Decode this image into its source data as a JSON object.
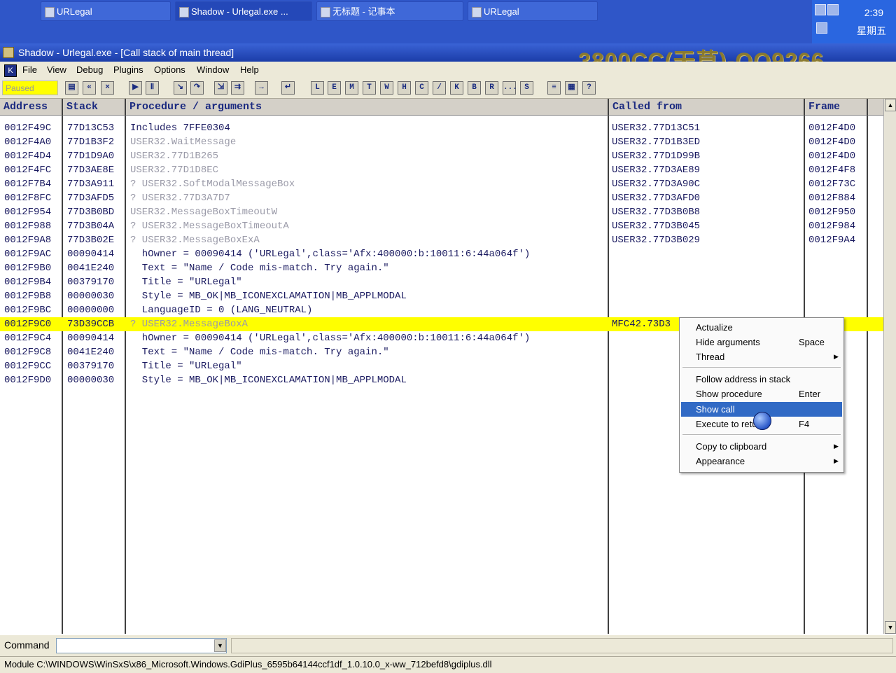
{
  "taskbar": {
    "tasks": [
      {
        "label": "URLegal"
      },
      {
        "label": "Shadow - Urlegal.exe ..."
      },
      {
        "label": "无标题 - 记事本"
      },
      {
        "label": "URLegal"
      }
    ],
    "clock": "2:39",
    "weekday": "星期五"
  },
  "window": {
    "title": "Shadow - Urlegal.exe - [Call stack of main thread]",
    "watermark": "3800CC(天草)-QQ9266…"
  },
  "menubar": {
    "items": [
      "File",
      "View",
      "Debug",
      "Plugins",
      "Options",
      "Window",
      "Help"
    ]
  },
  "toolbar": {
    "status": "Paused",
    "letter_buttons": [
      "L",
      "E",
      "M",
      "T",
      "W",
      "H",
      "C",
      "/",
      "K",
      "B",
      "R",
      "...",
      "S"
    ]
  },
  "table": {
    "headers": [
      "Address",
      "Stack",
      "Procedure / arguments",
      "Called from",
      "Frame"
    ],
    "rows": [
      {
        "addr": "0012F49C",
        "stack": "77D13C53",
        "proc": "Includes 7FFE0304",
        "call": "USER32.77D13C51",
        "frame": "0012F4D0"
      },
      {
        "addr": "0012F4A0",
        "stack": "77D1B3F2",
        "proc": "USER32.WaitMessage",
        "call": "USER32.77D1B3ED",
        "frame": "0012F4D0"
      },
      {
        "addr": "0012F4D4",
        "stack": "77D1D9A0",
        "proc": "USER32.77D1B265",
        "call": "USER32.77D1D99B",
        "frame": "0012F4D0"
      },
      {
        "addr": "0012F4FC",
        "stack": "77D3AE8E",
        "proc": "USER32.77D1D8EC",
        "call": "USER32.77D3AE89",
        "frame": "0012F4F8"
      },
      {
        "addr": "0012F7B4",
        "stack": "77D3A911",
        "proc": "? USER32.SoftModalMessageBox",
        "call": "USER32.77D3A90C",
        "frame": "0012F73C"
      },
      {
        "addr": "0012F8FC",
        "stack": "77D3AFD5",
        "proc": "? USER32.77D3A7D7",
        "call": "USER32.77D3AFD0",
        "frame": "0012F884"
      },
      {
        "addr": "0012F954",
        "stack": "77D3B0BD",
        "proc": "USER32.MessageBoxTimeoutW",
        "call": "USER32.77D3B0B8",
        "frame": "0012F950"
      },
      {
        "addr": "0012F988",
        "stack": "77D3B04A",
        "proc": "? USER32.MessageBoxTimeoutA",
        "call": "USER32.77D3B045",
        "frame": "0012F984"
      },
      {
        "addr": "0012F9A8",
        "stack": "77D3B02E",
        "proc": "? USER32.MessageBoxExA",
        "call": "USER32.77D3B029",
        "frame": "0012F9A4"
      },
      {
        "addr": "0012F9AC",
        "stack": "00090414",
        "proc": "  hOwner = 00090414 ('URLegal',class='Afx:400000:b:10011:6:44a064f')",
        "call": "",
        "frame": ""
      },
      {
        "addr": "0012F9B0",
        "stack": "0041E240",
        "proc": "  Text = \"Name / Code mis-match. Try again.\"",
        "call": "",
        "frame": ""
      },
      {
        "addr": "0012F9B4",
        "stack": "00379170",
        "proc": "  Title = \"URLegal\"",
        "call": "",
        "frame": ""
      },
      {
        "addr": "0012F9B8",
        "stack": "00000030",
        "proc": "  Style = MB_OK|MB_ICONEXCLAMATION|MB_APPLMODAL",
        "call": "",
        "frame": ""
      },
      {
        "addr": "0012F9BC",
        "stack": "00000000",
        "proc": "  LanguageID = 0 (LANG_NEUTRAL)",
        "call": "",
        "frame": ""
      },
      {
        "addr": "0012F9C0",
        "stack": "73D39CCB",
        "proc": "? USER32.MessageBoxA",
        "call": "MFC42.73D3",
        "frame": ""
      },
      {
        "addr": "0012F9C4",
        "stack": "00090414",
        "proc": "  hOwner = 00090414 ('URLegal',class='Afx:400000:b:10011:6:44a064f')",
        "call": "",
        "frame": ""
      },
      {
        "addr": "0012F9C8",
        "stack": "0041E240",
        "proc": "  Text = \"Name / Code mis-match. Try again.\"",
        "call": "",
        "frame": ""
      },
      {
        "addr": "0012F9CC",
        "stack": "00379170",
        "proc": "  Title = \"URLegal\"",
        "call": "",
        "frame": ""
      },
      {
        "addr": "0012F9D0",
        "stack": "00000030",
        "proc": "  Style = MB_OK|MB_ICONEXCLAMATION|MB_APPLMODAL",
        "call": "",
        "frame": ""
      }
    ]
  },
  "context_menu": {
    "items": [
      {
        "label": "Actualize",
        "shortcut": ""
      },
      {
        "label": "Hide arguments",
        "shortcut": "Space"
      },
      {
        "label": "Thread",
        "shortcut": "",
        "submenu": "▶"
      },
      {
        "label": "Follow address in stack",
        "shortcut": ""
      },
      {
        "label": "Show procedure",
        "shortcut": "Enter"
      },
      {
        "label": "Show call",
        "shortcut": ""
      },
      {
        "label": "Execute to return",
        "shortcut": "F4"
      },
      {
        "label": "Copy to clipboard",
        "shortcut": "",
        "submenu": "▶"
      },
      {
        "label": "Appearance",
        "shortcut": "",
        "submenu": "▶"
      }
    ]
  },
  "command": {
    "label": "Command",
    "value": ""
  },
  "statusbar": {
    "text": "Module C:\\WINDOWS\\WinSxS\\x86_Microsoft.Windows.GdiPlus_6595b64144ccf1df_1.0.10.0_x-ww_712befd8\\gdiplus.dll"
  },
  "colors": {
    "selected_row": "#ffff00",
    "menu_highlight": "#316ac5",
    "title_bar": "#1b3da8"
  }
}
